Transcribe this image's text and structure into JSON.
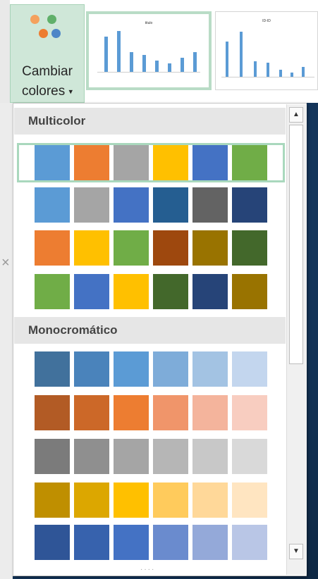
{
  "ribbon": {
    "change_colors_label_line1": "Cambiar",
    "change_colors_label_line2": "colores",
    "caret_icon": "▾",
    "palette_dots": [
      "#f4a15d",
      "#60b06a",
      "#ed7d31",
      "#4e86c7"
    ],
    "thumb1_title": "titulo",
    "thumb2_title": "ID-ID"
  },
  "dropdown": {
    "sections": [
      {
        "title": "Multicolor",
        "rows": [
          [
            "#5b9bd5",
            "#ed7d31",
            "#a5a5a5",
            "#ffc000",
            "#4472c4",
            "#70ad47"
          ],
          [
            "#5b9bd5",
            "#a5a5a5",
            "#4472c4",
            "#255e91",
            "#636363",
            "#264478"
          ],
          [
            "#ed7d31",
            "#ffc000",
            "#70ad47",
            "#9e480e",
            "#997300",
            "#43682b"
          ],
          [
            "#70ad47",
            "#4472c4",
            "#ffc000",
            "#43682b",
            "#264478",
            "#997300"
          ]
        ]
      },
      {
        "title": "Monocromático",
        "rows": [
          [
            "#41719c",
            "#4a83bb",
            "#5b9bd5",
            "#7eacd9",
            "#a3c3e3",
            "#c3d6ee"
          ],
          [
            "#b25b25",
            "#cc6828",
            "#ed7d31",
            "#f0956a",
            "#f4b49c",
            "#f8cdc0"
          ],
          [
            "#7b7b7b",
            "#8f8f8f",
            "#a5a5a5",
            "#b6b6b6",
            "#c8c8c8",
            "#d9d9d9"
          ],
          [
            "#bf8f00",
            "#dca700",
            "#ffc000",
            "#ffcb5c",
            "#ffd899",
            "#ffe5c1"
          ],
          [
            "#2f5597",
            "#3762ad",
            "#4472c4",
            "#6a8bce",
            "#94a9d9",
            "#b9c6e6"
          ]
        ]
      }
    ],
    "scroll_up_icon": "▲",
    "scroll_down_icon": "▼",
    "resize_grip_icon": "····"
  }
}
